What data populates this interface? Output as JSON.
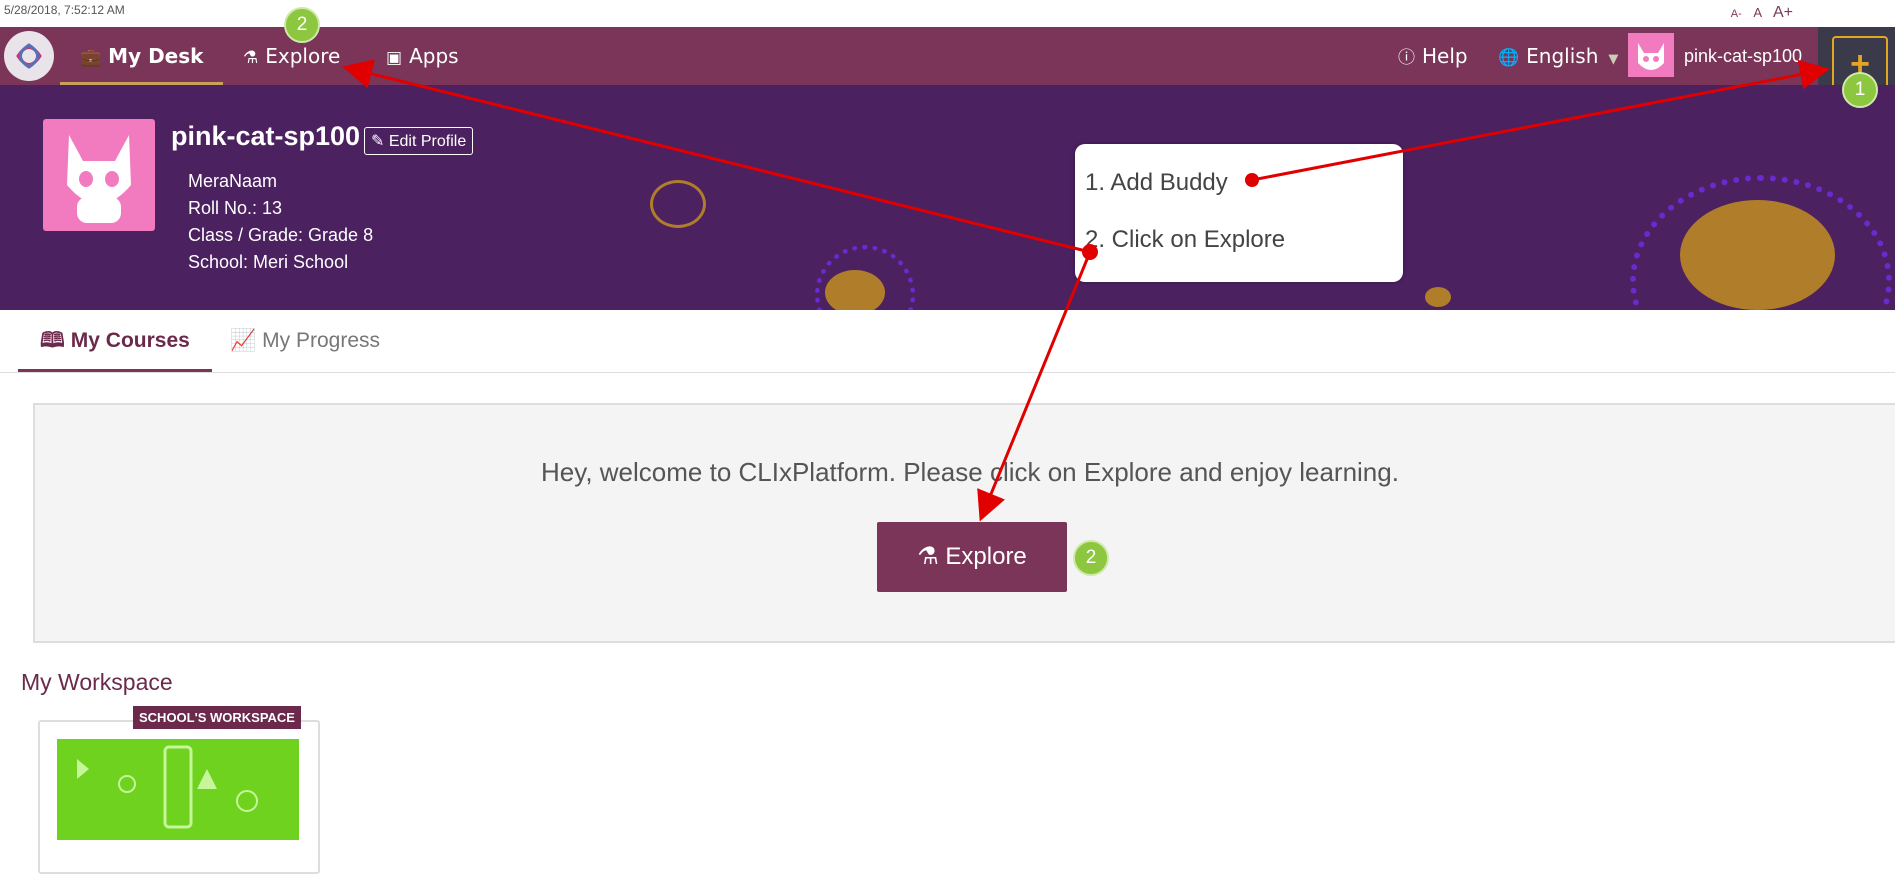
{
  "timestamp": "5/28/2018, 7:52:12 AM",
  "font_size_controls": [
    "A-",
    "A",
    "A+"
  ],
  "nav": {
    "my_desk": "My Desk",
    "explore": "Explore",
    "apps": "Apps",
    "help": "Help",
    "language": "English",
    "username": "pink-cat-sp100",
    "add_button": "+"
  },
  "profile": {
    "name": "pink-cat-sp100",
    "edit_label": "Edit Profile",
    "full_name": "MeraNaam",
    "roll_no": "Roll No.: 13",
    "class_grade": "Class / Grade: Grade 8",
    "school": "School: Meri School"
  },
  "callout": {
    "step1": "1. Add Buddy",
    "step2": "2. Click on Explore"
  },
  "tabs": {
    "courses": "My Courses",
    "progress": "My Progress"
  },
  "welcome": {
    "message": "Hey, welcome to CLIxPlatform. Please click on Explore and enjoy learning.",
    "explore_button": "Explore"
  },
  "workspace": {
    "title": "My Workspace",
    "badge": "SCHOOL'S WORKSPACE"
  },
  "annotations": {
    "badge_explore_nav": "2",
    "badge_add": "1",
    "badge_explore_btn": "2"
  },
  "colors": {
    "nav_bg": "#7a3558",
    "header_bg": "#4b2160",
    "accent_orange": "#e3a623",
    "badge_green": "#8dc63f",
    "arrow_red": "#e00000"
  }
}
